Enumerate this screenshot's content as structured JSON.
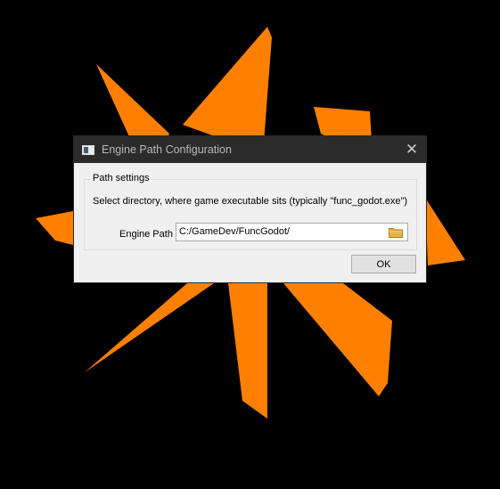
{
  "window": {
    "title": "Engine Path Configuration",
    "close_symbol": "✕"
  },
  "group": {
    "title": "Path settings",
    "description": "Select directory, where game executable sits (typically \"func_godot.exe\")"
  },
  "engine_path": {
    "label": "Engine Path",
    "value": "C:/GameDev/FuncGodot/"
  },
  "buttons": {
    "ok_label": "OK"
  },
  "icons": {
    "app": "application-window-icon",
    "close": "close-icon",
    "browse": "folder-icon",
    "background": "orange-pinwheel-logo"
  },
  "colors": {
    "background": "#000000",
    "logo": "#ff8000",
    "titlebar": "#2b2b2b",
    "dialog": "#f0f0f0"
  }
}
